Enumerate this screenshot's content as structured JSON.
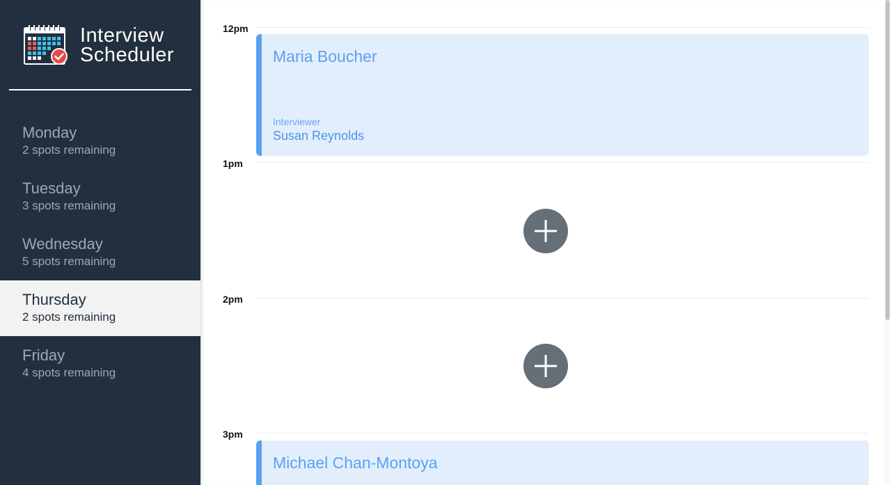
{
  "app": {
    "title_line1": "Interview",
    "title_line2": "Scheduler",
    "logo_icon": "calendar-check-icon"
  },
  "sidebar": {
    "days": [
      {
        "name": "Monday",
        "spots": "2 spots remaining",
        "selected": false
      },
      {
        "name": "Tuesday",
        "spots": "3 spots remaining",
        "selected": false
      },
      {
        "name": "Wednesday",
        "spots": "5 spots remaining",
        "selected": false
      },
      {
        "name": "Thursday",
        "spots": "2 spots remaining",
        "selected": true
      },
      {
        "name": "Friday",
        "spots": "4 spots remaining",
        "selected": false
      }
    ]
  },
  "schedule": {
    "slots": [
      {
        "time": "12pm",
        "student": "Maria Boucher",
        "interviewer_label": "Interviewer",
        "interviewer": "Susan Reynolds"
      },
      {
        "time": "1pm",
        "empty": true
      },
      {
        "time": "2pm",
        "empty": true
      },
      {
        "time": "3pm",
        "student": "Michael Chan-Montoya"
      }
    ],
    "add_icon": "plus-icon"
  },
  "colors": {
    "sidebar_bg": "#222f3e",
    "selected_bg": "#f2f2f2",
    "appointment_bg": "#e3eefc",
    "accent": "#5aa1f0",
    "add_button": "#666e78"
  }
}
